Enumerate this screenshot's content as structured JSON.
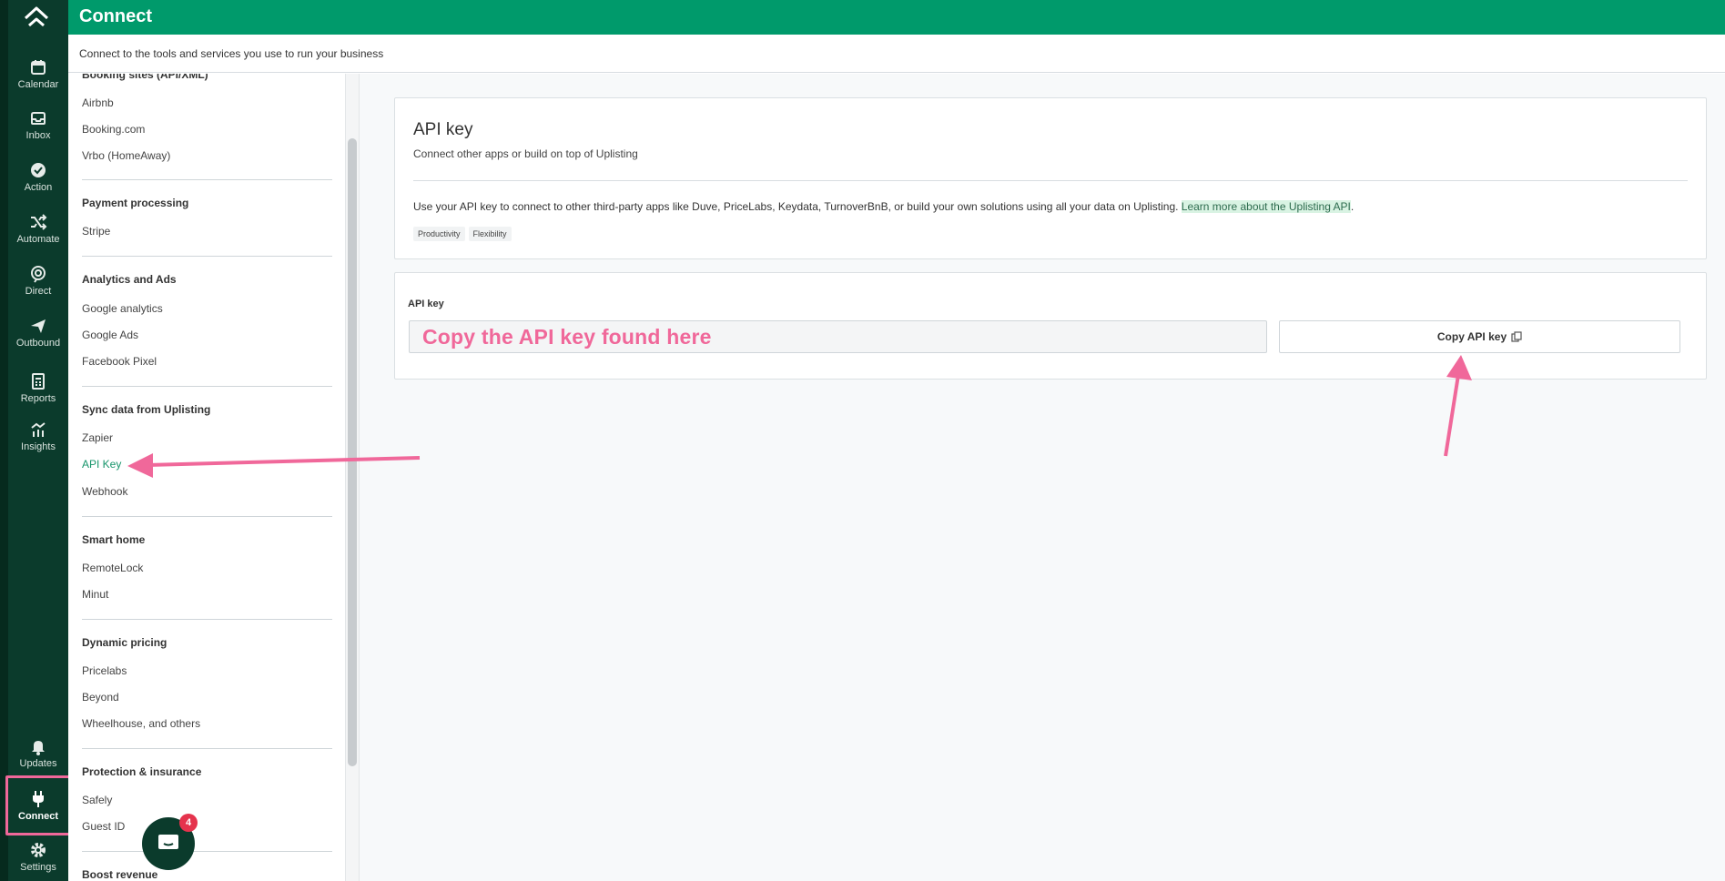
{
  "app": {
    "title": "Connect",
    "subtitle": "Connect to the tools and services you use to run your business"
  },
  "rail": {
    "items": [
      {
        "label": "Calendar",
        "icon": "calendar-icon"
      },
      {
        "label": "Inbox",
        "icon": "inbox-icon"
      },
      {
        "label": "Action",
        "icon": "check-circle-icon"
      },
      {
        "label": "Automate",
        "icon": "shuffle-icon"
      },
      {
        "label": "Direct",
        "icon": "direct-icon"
      },
      {
        "label": "Outbound",
        "icon": "send-icon"
      },
      {
        "label": "Reports",
        "icon": "reports-icon"
      },
      {
        "label": "Insights",
        "icon": "insights-icon"
      },
      {
        "label": "Updates",
        "icon": "bell-icon"
      },
      {
        "label": "Connect",
        "icon": "plug-icon"
      },
      {
        "label": "Settings",
        "icon": "gear-icon"
      }
    ]
  },
  "list": {
    "sections": [
      {
        "title": "Booking sites (API/XML)",
        "items": [
          "Airbnb",
          "Booking.com",
          "Vrbo (HomeAway)"
        ]
      },
      {
        "title": "Payment processing",
        "items": [
          "Stripe"
        ]
      },
      {
        "title": "Analytics and Ads",
        "items": [
          "Google analytics",
          "Google Ads",
          "Facebook Pixel"
        ]
      },
      {
        "title": "Sync data from Uplisting",
        "items": [
          "Zapier",
          "API Key",
          "Webhook"
        ]
      },
      {
        "title": "Smart home",
        "items": [
          "RemoteLock",
          "Minut"
        ]
      },
      {
        "title": "Dynamic pricing",
        "items": [
          "Pricelabs",
          "Beyond",
          "Wheelhouse, and others"
        ]
      },
      {
        "title": "Protection & insurance",
        "items": [
          "Safely",
          "Guest ID"
        ]
      },
      {
        "title": "Boost revenue",
        "items": []
      }
    ],
    "active_item": "API Key"
  },
  "card": {
    "title": "API key",
    "subtitle": "Connect other apps or build on top of Uplisting",
    "description": "Use your API key to connect to other third-party apps like Duve, PriceLabs, Keydata, TurnoverBnB, or build your own solutions using all your data on Uplisting. ",
    "link_text": "Learn more about the Uplisting API",
    "link_suffix": ".",
    "tags": [
      "Productivity",
      "Flexibility"
    ]
  },
  "key_card": {
    "label": "API key",
    "annotation": "Copy the API key found here",
    "copy_button": "Copy API key"
  },
  "chat": {
    "badge": "4"
  },
  "colors": {
    "brand": "#009a6b",
    "rail": "#0b3b2c",
    "annotation": "#f0689a"
  }
}
